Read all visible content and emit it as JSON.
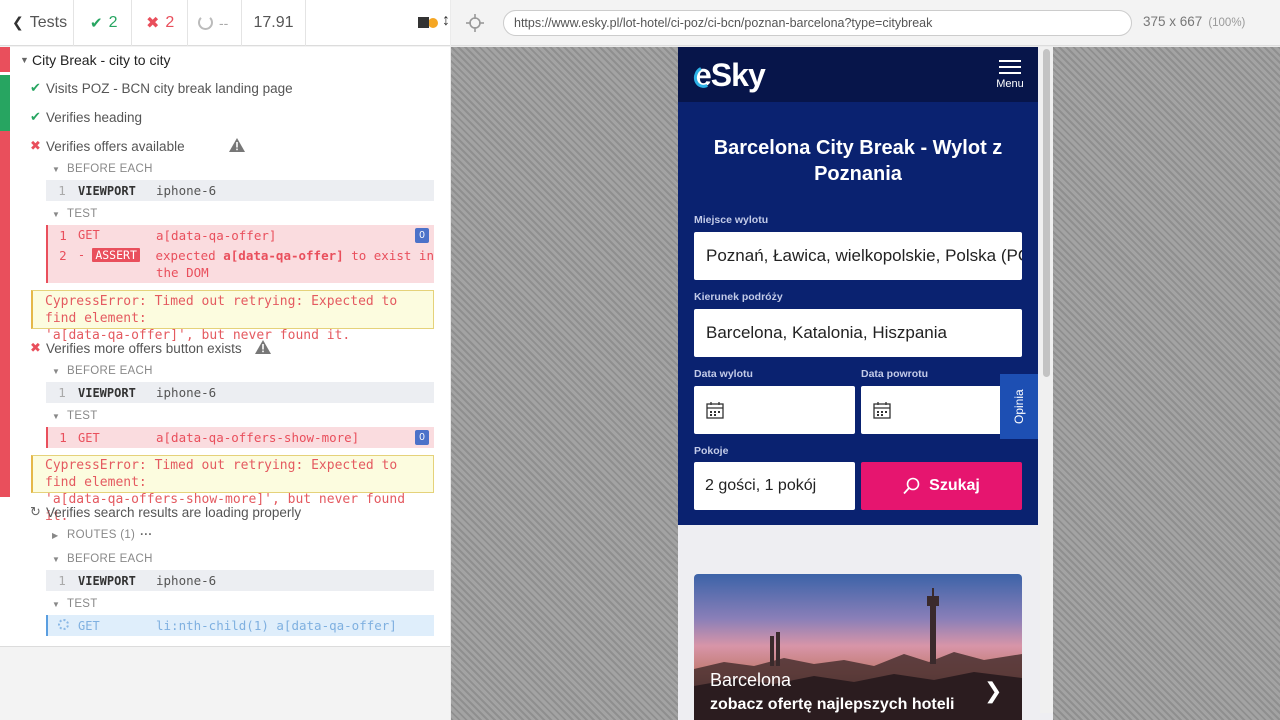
{
  "stats": {
    "tests_label": "Tests",
    "passed": "2",
    "failed": "2",
    "pending": "--",
    "duration": "17.91"
  },
  "suite": {
    "title": "City Break - city to city",
    "tests": [
      {
        "title": "Visits POZ - BCN city break landing page",
        "state": "passed"
      },
      {
        "title": "Verifies heading",
        "state": "passed"
      },
      {
        "title": "Verifies offers available",
        "state": "failed",
        "before_each": "BEFORE EACH",
        "before_cmd": {
          "num": "1",
          "name": "VIEWPORT",
          "msg": "iphone-6"
        },
        "test_label": "TEST",
        "cmds": [
          {
            "num": "1",
            "name": "GET",
            "msg": "a[data-qa-offer]",
            "badge": "0"
          },
          {
            "num": "2",
            "name": "ASSERT",
            "prefix": "-",
            "msg_pre": "expected",
            "msg_strong": "a[data-qa-offer]",
            "msg_post": "to exist in",
            "msg_line2": "the DOM"
          }
        ],
        "error_line1": "CypressError: Timed out retrying: Expected to find element:",
        "error_line2": "'a[data-qa-offer]', but never found it."
      },
      {
        "title": "Verifies more offers button exists",
        "state": "failed",
        "before_each": "BEFORE EACH",
        "before_cmd": {
          "num": "1",
          "name": "VIEWPORT",
          "msg": "iphone-6"
        },
        "test_label": "TEST",
        "cmds": [
          {
            "num": "1",
            "name": "GET",
            "msg": "a[data-qa-offers-show-more]",
            "badge": "0"
          }
        ],
        "error_line1": "CypressError: Timed out retrying: Expected to find element:",
        "error_line2": "'a[data-qa-offers-show-more]', but never found it."
      },
      {
        "title": "Verifies search results are loading properly",
        "state": "running",
        "routes": "ROUTES (1)",
        "before_each": "BEFORE EACH",
        "before_cmd": {
          "num": "1",
          "name": "VIEWPORT",
          "msg": "iphone-6"
        },
        "test_label": "TEST",
        "cmds": [
          {
            "name": "GET",
            "msg": "li:nth-child(1) a[data-qa-offer]"
          }
        ]
      }
    ]
  },
  "aut": {
    "url": "https://www.esky.pl/lot-hotel/ci-poz/ci-bcn/poznan-barcelona?type=citybreak",
    "viewport": "375 x 667",
    "zoom": "(100%)"
  },
  "site": {
    "logo": "eSky",
    "menu_label": "Menu",
    "hero_title": "Barcelona City Break - Wylot z Poznania",
    "origin_label": "Miejsce wylotu",
    "origin_value": "Poznań, Ławica, wielkopolskie, Polska (POZ)",
    "dest_label": "Kierunek podróży",
    "dest_value": "Barcelona, Katalonia, Hiszpania",
    "depart_label": "Data wylotu",
    "return_label": "Data powrotu",
    "rooms_label": "Pokoje",
    "rooms_value": "2 gości, 1 pokój",
    "search_label": "Szukaj",
    "feedback_label": "Opinia",
    "promo_city": "Barcelona",
    "promo_sub": "zobacz ofertę najlepszych hoteli"
  },
  "colors": {
    "pass": "#27a561",
    "fail": "#e94f5c",
    "brand_navy": "#0a2270",
    "brand_pink": "#e6156f"
  }
}
